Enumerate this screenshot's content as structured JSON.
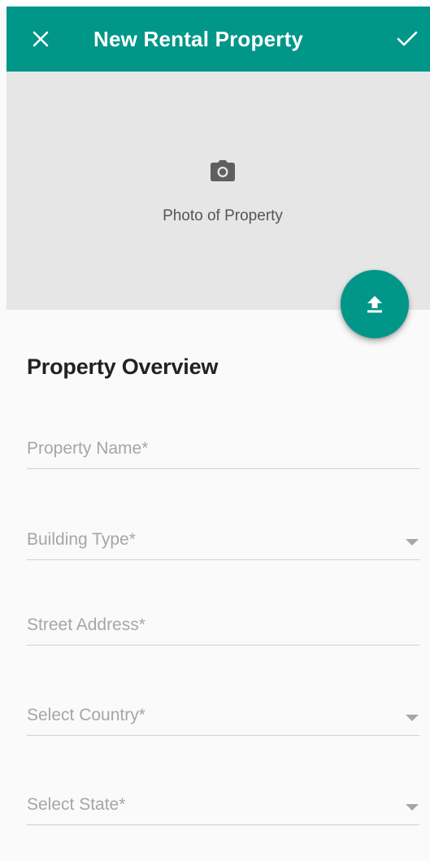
{
  "appbar": {
    "title": "New Rental Property",
    "close_icon": "close-icon",
    "confirm_icon": "check-icon",
    "color": "#009688"
  },
  "photo": {
    "label": "Photo of Property",
    "icon": "camera-icon",
    "upload_icon": "upload-icon"
  },
  "form": {
    "section_title": "Property Overview",
    "fields": [
      {
        "label": "Property Name*",
        "type": "text"
      },
      {
        "label": "Building Type*",
        "type": "dropdown"
      },
      {
        "label": "Street Address*",
        "type": "text"
      },
      {
        "label": "Select Country*",
        "type": "dropdown"
      },
      {
        "label": "Select State*",
        "type": "dropdown"
      }
    ]
  }
}
